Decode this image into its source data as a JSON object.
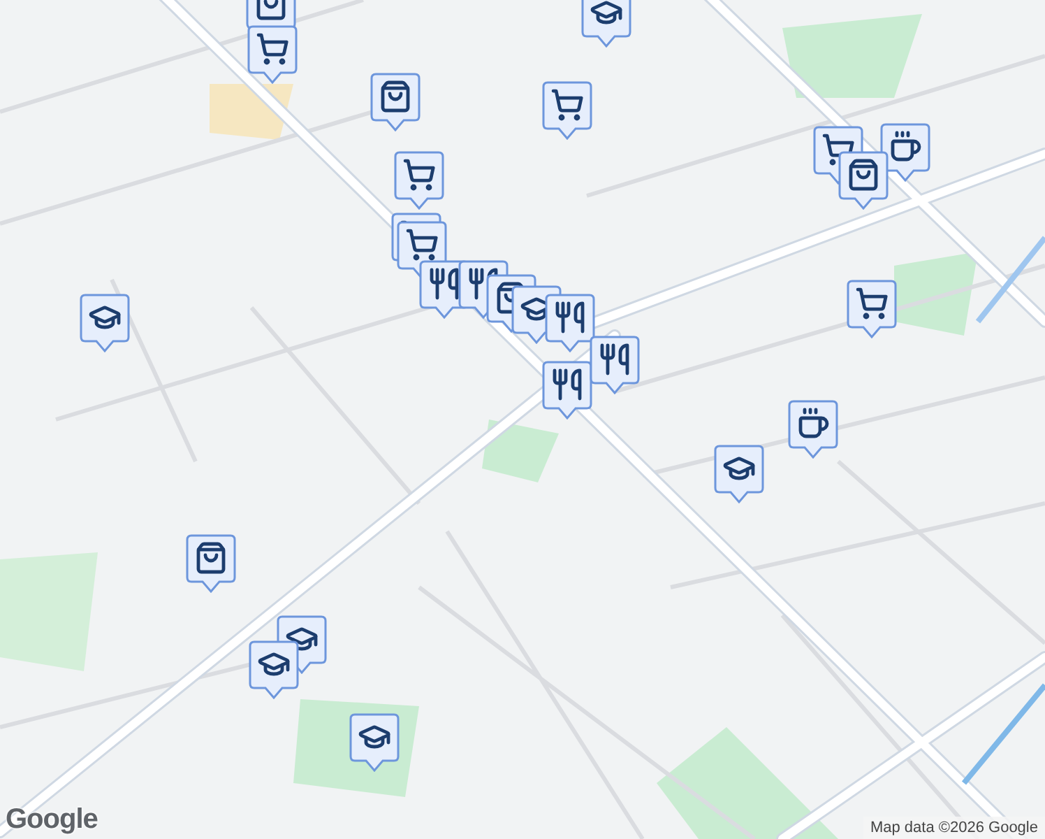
{
  "map": {
    "markers": [
      {
        "kind": "bag"
      },
      {
        "kind": "cart"
      },
      {
        "kind": "bag"
      },
      {
        "kind": "cap"
      },
      {
        "kind": "cart"
      },
      {
        "kind": "cart"
      },
      {
        "kind": "cup"
      },
      {
        "kind": "bag"
      },
      {
        "kind": "cart"
      },
      {
        "kind": "cart"
      },
      {
        "kind": "cart"
      },
      {
        "kind": "fork"
      },
      {
        "kind": "fork"
      },
      {
        "kind": "bag"
      },
      {
        "kind": "cap"
      },
      {
        "kind": "fork"
      },
      {
        "kind": "fork"
      },
      {
        "kind": "fork"
      },
      {
        "kind": "cart"
      },
      {
        "kind": "cap"
      },
      {
        "kind": "cup"
      },
      {
        "kind": "cap"
      },
      {
        "kind": "bag"
      },
      {
        "kind": "cap"
      },
      {
        "kind": "cap"
      },
      {
        "kind": "cap"
      }
    ]
  },
  "logo": "Google",
  "attribution": "Map data ©2026 Google"
}
